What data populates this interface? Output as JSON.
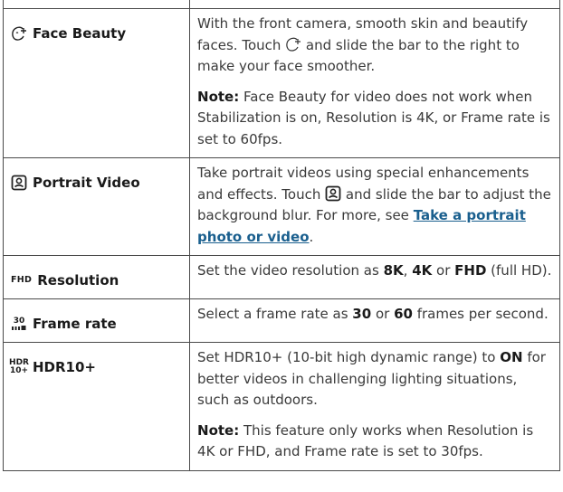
{
  "rows": [
    {
      "feature": "Face Beauty",
      "icon": "face-beauty-icon",
      "p1_a": "With the front camera, smooth skin and beautify faces. Touch ",
      "p1_b": " and slide the bar to the right to make your face smoother.",
      "note_label": "Note:",
      "note_text": " Face Beauty for video does not work when Stabilization is on, Resolution is 4K, or Frame rate is set to 60fps."
    },
    {
      "feature": "Portrait Video",
      "icon": "portrait-icon",
      "p1_a": "Take portrait videos using special enhancements and effects. Touch ",
      "p1_b": " and slide the bar to adjust the background blur. For more, see ",
      "link_text": "Take a portrait photo or video",
      "p1_c": "."
    },
    {
      "feature": "Resolution",
      "icon_text": "FHD",
      "p1_a": "Set the video resolution as ",
      "opt1": "8K",
      "sep1": ", ",
      "opt2": "4K",
      "sep2": " or ",
      "opt3": "FHD",
      "p1_b": " (full HD)."
    },
    {
      "feature": "Frame rate",
      "icon_text": "30",
      "p1_a": "Select a frame rate as ",
      "opt1": "30",
      "sep1": " or ",
      "opt2": "60",
      "p1_b": " frames per second."
    },
    {
      "feature": "HDR10+",
      "icon_text_top": "HDR",
      "icon_text_bottom": "10+",
      "p1_a": "Set HDR10+ (10-bit high dynamic range) to ",
      "opt1": "ON",
      "p1_b": " for better videos in challenging lighting situations, such as outdoors.",
      "note_label": "Note:",
      "note_text": " This feature only works when Resolution is 4K or FHD, and Frame rate is set to 30fps."
    }
  ]
}
